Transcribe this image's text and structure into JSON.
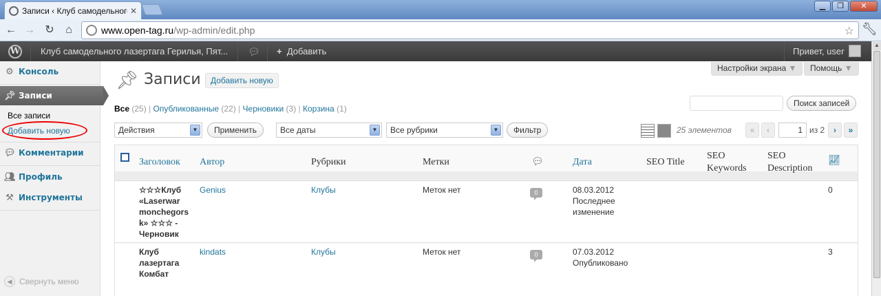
{
  "browser": {
    "tab_title": "Записи ‹ Клуб самодельного",
    "url_host": "www.open-tag.ru",
    "url_path": "/wp-admin/edit.php"
  },
  "admin_bar": {
    "site_name": "Клуб самодельного лазертага Герилья, Пят...",
    "add_label": "Добавить",
    "howdy": "Привет, user"
  },
  "sidebar": {
    "items": [
      {
        "label": "Консоль",
        "icon": "dashboard-icon"
      },
      {
        "label": "Записи",
        "icon": "pin-icon"
      },
      {
        "label": "Комментарии",
        "icon": "comment-icon"
      },
      {
        "label": "Профиль",
        "icon": "users-icon"
      },
      {
        "label": "Инструменты",
        "icon": "tools-icon"
      }
    ],
    "sub_all": "Все записи",
    "sub_new": "Добавить новую",
    "collapse": "Свернуть меню"
  },
  "page": {
    "title": "Записи",
    "add_new": "Добавить новую",
    "screen_options": "Настройки экрана",
    "help": "Помощь"
  },
  "views": {
    "all": "Все",
    "all_count": "(25)",
    "published": "Опубликованные",
    "published_count": "(22)",
    "drafts": "Черновики",
    "drafts_count": "(3)",
    "trash": "Корзина",
    "trash_count": "(1)"
  },
  "filters": {
    "search_button": "Поиск записей",
    "bulk_action": "Действия",
    "apply": "Применить",
    "dates": "Все даты",
    "categories": "Все рубрики",
    "filter": "Фильтр",
    "items_count": "25 элементов",
    "current_page": "1",
    "of_pages": "из 2",
    "first": "«",
    "prev": "‹",
    "next": "›",
    "last": "»"
  },
  "table": {
    "columns": {
      "title": "Заголовок",
      "author": "Автор",
      "categories": "Рубрики",
      "tags": "Метки",
      "date": "Дата",
      "seo_title": "SEO Title",
      "seo_keywords": "SEO Keywords",
      "seo_description": "SEO Description"
    },
    "rows": [
      {
        "title": "☆☆☆Клуб «Laserwar monchegorsk» ☆☆☆ - Черновик",
        "author": "Genius",
        "category": "Клубы",
        "tags": "Меток нет",
        "comments": "0",
        "date": "08.03.2012",
        "status": "Последнее изменение",
        "stat": "0"
      },
      {
        "title": "Клуб лазертага Комбат",
        "author": "kindats",
        "category": "Клубы",
        "tags": "Меток нет",
        "comments": "0",
        "date": "07.03.2012",
        "status": "Опубликовано",
        "stat": "3"
      }
    ]
  }
}
